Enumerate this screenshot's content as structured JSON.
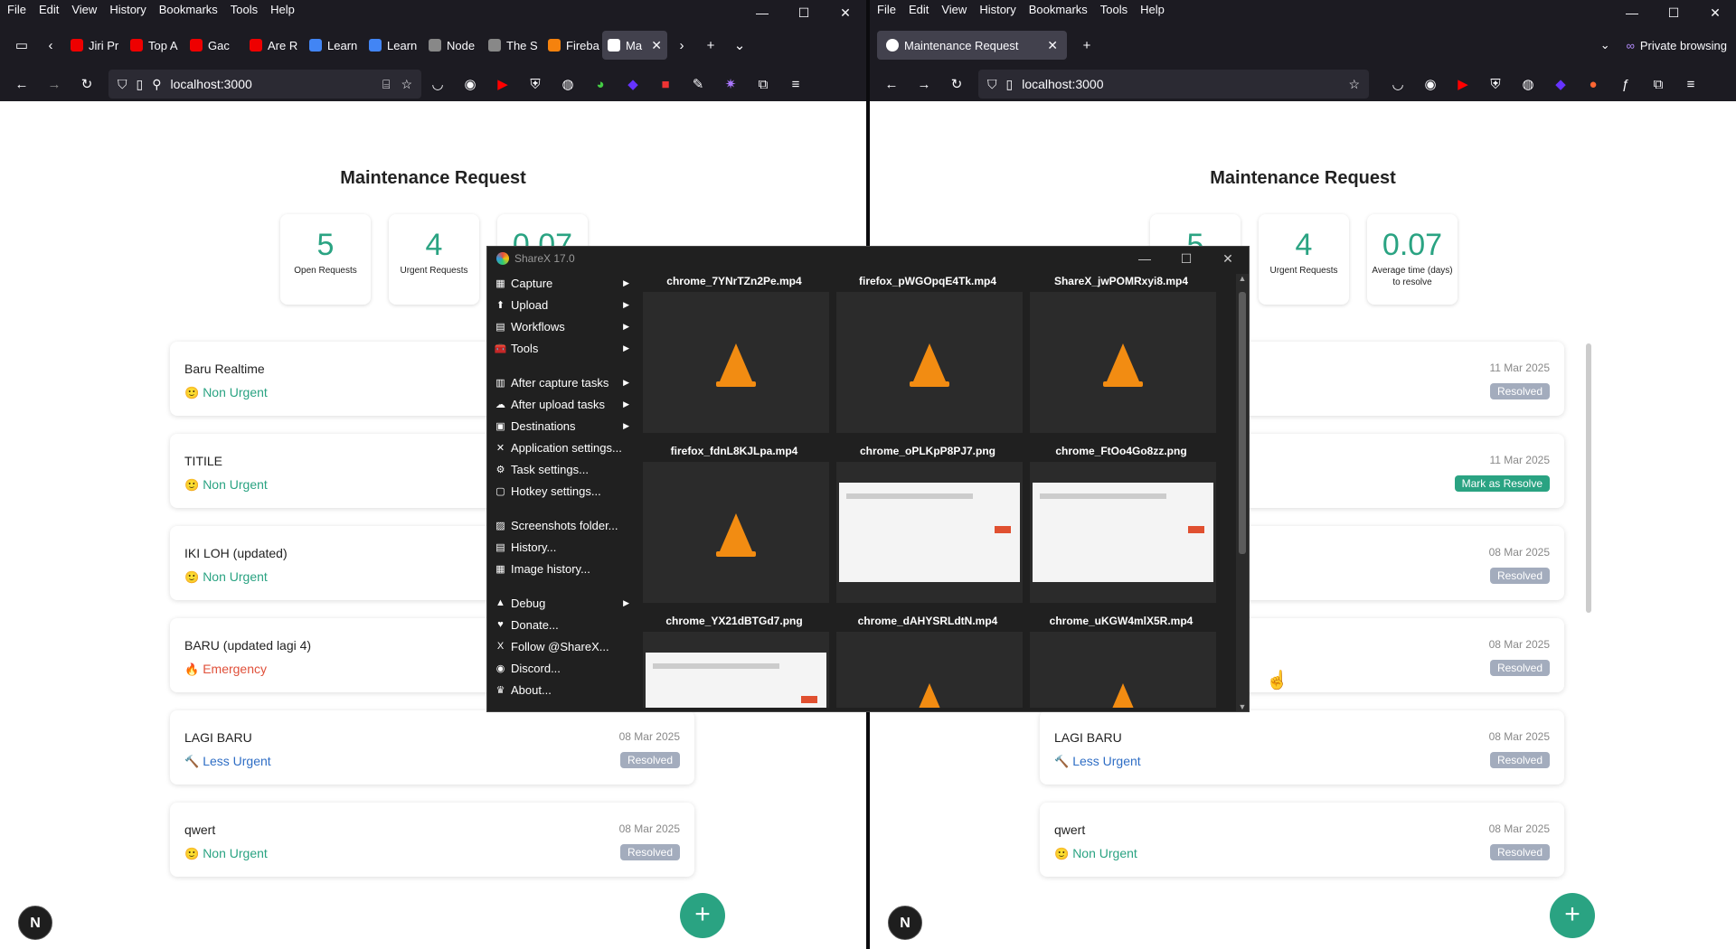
{
  "menu": [
    "File",
    "Edit",
    "View",
    "History",
    "Bookmarks",
    "Tools",
    "Help"
  ],
  "left": {
    "tabs": [
      {
        "label": "Jiri Pr",
        "color": "#e00"
      },
      {
        "label": "Top A",
        "color": "#e00"
      },
      {
        "label": "Gac",
        "color": "#e00"
      },
      {
        "label": "Are R",
        "color": "#e00"
      },
      {
        "label": "Learn",
        "color": "#4285f4"
      },
      {
        "label": "Learn",
        "color": "#4285f4"
      },
      {
        "label": "Node",
        "color": "#888"
      },
      {
        "label": "The S",
        "color": "#888"
      },
      {
        "label": "Fireba",
        "color": "#f5820d"
      },
      {
        "label": "Ma",
        "color": "#fff"
      }
    ],
    "url": "localhost:3000"
  },
  "right": {
    "tab_label": "Maintenance Request",
    "url": "localhost:3000",
    "private_label": "Private browsing"
  },
  "app": {
    "title": "Maintenance Request",
    "stats": [
      {
        "value": "5",
        "label": "Open Requests"
      },
      {
        "value": "4",
        "label": "Urgent Requests"
      },
      {
        "value": "0.07",
        "label": "Average time (days) to resolve"
      }
    ],
    "requests": [
      {
        "title": "Baru Realtime",
        "priority": "Non Urgent",
        "icon": "🙂",
        "date": "11 Mar 2025",
        "status": "Resolved"
      },
      {
        "title": "TITILE",
        "priority": "Non Urgent",
        "icon": "🙂",
        "date": "11 Mar 2025",
        "status": "Mark as Resolve"
      },
      {
        "title": "IKI LOH (updated)",
        "priority": "Non Urgent",
        "icon": "🙂",
        "date": "08 Mar 2025",
        "status": "Resolved"
      },
      {
        "title": "BARU (updated lagi 4)",
        "priority": "Emergency",
        "icon": "🔥",
        "date": "08 Mar 2025",
        "status": "Resolved"
      },
      {
        "title": "LAGI BARU",
        "priority": "Less Urgent",
        "icon": "🔨",
        "date": "08 Mar 2025",
        "status": "Resolved"
      },
      {
        "title": "qwert",
        "priority": "Non Urgent",
        "icon": "🙂",
        "date": "08 Mar 2025",
        "status": "Resolved"
      }
    ],
    "fab": "+",
    "nextjs_logo": "N"
  },
  "sharex": {
    "title": "ShareX 17.0",
    "menu": [
      {
        "label": "Capture",
        "icon": "▦",
        "sub": true
      },
      {
        "label": "Upload",
        "icon": "⬆",
        "sub": true
      },
      {
        "label": "Workflows",
        "icon": "▤",
        "sub": true
      },
      {
        "label": "Tools",
        "icon": "🧰",
        "sub": true
      },
      {
        "gap": true
      },
      {
        "label": "After capture tasks",
        "icon": "▥",
        "sub": true
      },
      {
        "label": "After upload tasks",
        "icon": "☁",
        "sub": true
      },
      {
        "label": "Destinations",
        "icon": "▣",
        "sub": true
      },
      {
        "label": "Application settings...",
        "icon": "✕",
        "sub": false
      },
      {
        "label": "Task settings...",
        "icon": "⚙",
        "sub": false
      },
      {
        "label": "Hotkey settings...",
        "icon": "▢",
        "sub": false
      },
      {
        "gap": true
      },
      {
        "label": "Screenshots folder...",
        "icon": "▨",
        "sub": false
      },
      {
        "label": "History...",
        "icon": "▤",
        "sub": false
      },
      {
        "label": "Image history...",
        "icon": "▦",
        "sub": false
      },
      {
        "gap": true
      },
      {
        "label": "Debug",
        "icon": "▲",
        "sub": true
      },
      {
        "label": "Donate...",
        "icon": "♥",
        "sub": false
      },
      {
        "label": "Follow @ShareX...",
        "icon": "X",
        "sub": false
      },
      {
        "label": "Discord...",
        "icon": "◉",
        "sub": false
      },
      {
        "label": "About...",
        "icon": "♛",
        "sub": false
      }
    ],
    "files": [
      {
        "name": "chrome_7YNrTZn2Pe.mp4",
        "kind": "video"
      },
      {
        "name": "firefox_pWGOpqE4Tk.mp4",
        "kind": "video"
      },
      {
        "name": "ShareX_jwPOMRxyi8.mp4",
        "kind": "video"
      },
      {
        "name": "firefox_fdnL8KJLpa.mp4",
        "kind": "video"
      },
      {
        "name": "chrome_oPLKpP8PJ7.png",
        "kind": "image"
      },
      {
        "name": "chrome_FtOo4Go8zz.png",
        "kind": "image"
      },
      {
        "name": "chrome_YX21dBTGd7.png",
        "kind": "image"
      },
      {
        "name": "chrome_dAHYSRLdtN.mp4",
        "kind": "video"
      },
      {
        "name": "chrome_uKGW4mlX5R.mp4",
        "kind": "video"
      }
    ]
  }
}
